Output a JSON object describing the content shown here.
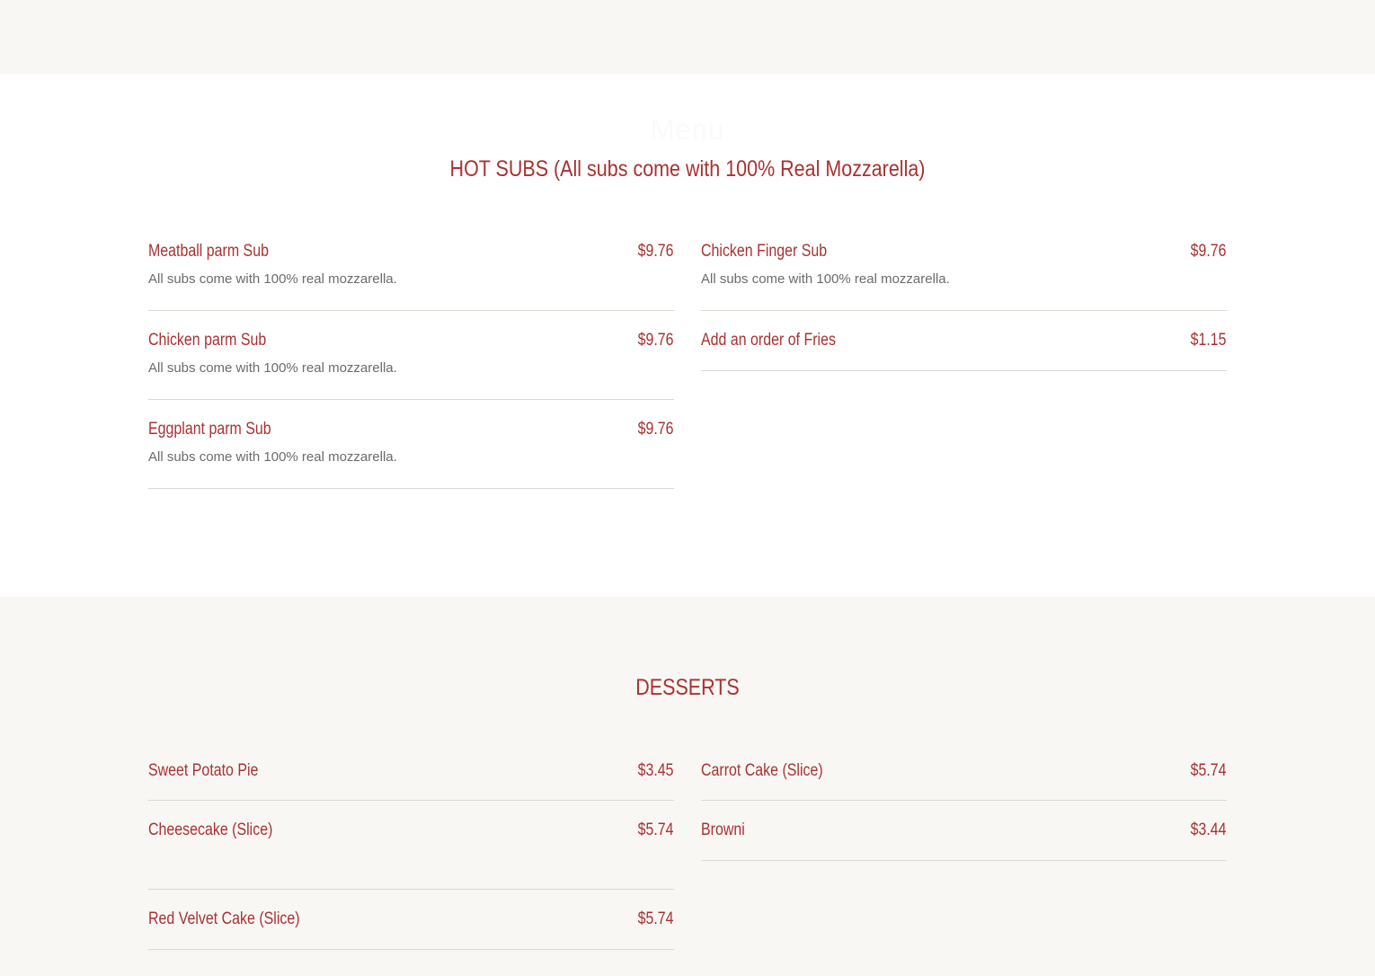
{
  "menu": {
    "heading": "Menu"
  },
  "hot_subs": {
    "title": "HOT SUBS (All subs come with 100% Real Mozzarella)",
    "left": [
      {
        "name": "Meatball parm Sub",
        "price": "$9.76",
        "desc": "All subs come with 100% real mozzarella."
      },
      {
        "name": "Chicken parm Sub",
        "price": "$9.76",
        "desc": "All subs come with 100% real mozzarella."
      },
      {
        "name": "Eggplant parm Sub",
        "price": "$9.76",
        "desc": "All subs come with 100% real mozzarella."
      }
    ],
    "right": [
      {
        "name": "Chicken Finger Sub",
        "price": "$9.76",
        "desc": "All subs come with 100% real mozzarella."
      },
      {
        "name": "Add an order of Fries",
        "price": "$1.15"
      }
    ]
  },
  "desserts": {
    "title": "DESSERTS",
    "left": [
      {
        "name": "Sweet Potato Pie",
        "price": "$3.45"
      },
      {
        "name": "Cheesecake (Slice)",
        "price": "$5.74"
      },
      {
        "name": "Red Velvet Cake (Slice)",
        "price": "$5.74"
      }
    ],
    "right": [
      {
        "name": "Carrot Cake (Slice)",
        "price": "$5.74"
      },
      {
        "name": "Browni",
        "price": "$3.44"
      }
    ]
  },
  "colors": {
    "accent": "#a83232",
    "background": "#f8f7f4",
    "panel": "#ffffff",
    "description": "#6b6b6b",
    "divider": "#dcd8d2"
  }
}
